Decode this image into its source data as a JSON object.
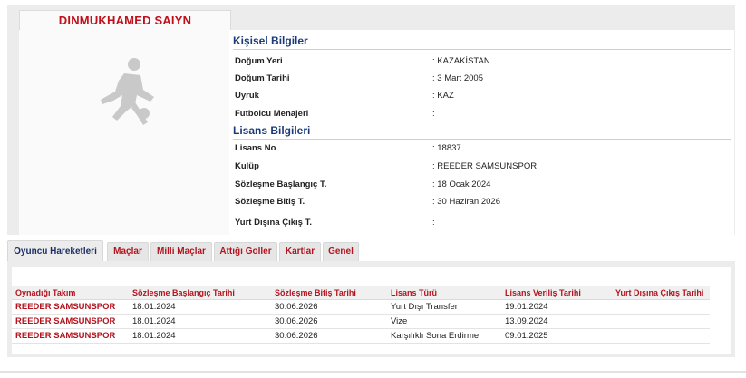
{
  "player": {
    "name": "DINMUKHAMED SAIYN"
  },
  "personal": {
    "title": "Kişisel Bilgiler",
    "rows": [
      {
        "label": "Doğum Yeri",
        "value": ":  KAZAKİSTAN"
      },
      {
        "label": "Doğum Tarihi",
        "value": ":  3 Mart 2005"
      },
      {
        "label": "Uyruk",
        "value": ":  KAZ"
      },
      {
        "label": "Futbolcu Menajeri",
        "value": ":"
      }
    ]
  },
  "license": {
    "title": "Lisans Bilgileri",
    "rows": [
      {
        "label": "Lisans No",
        "value": ": 18837"
      },
      {
        "label": "Kulüp",
        "value": ": REEDER SAMSUNSPOR"
      },
      {
        "label": "Sözleşme Başlangıç T.",
        "value": ": 18 Ocak 2024"
      },
      {
        "label": "Sözleşme Bitiş T.",
        "value": ": 30 Haziran 2026"
      },
      {
        "label": "Yurt Dışına Çıkış T.",
        "value": ":"
      }
    ]
  },
  "tabs": [
    "Oyuncu Hareketleri",
    "Maçlar",
    "Milli Maçlar",
    "Attığı Goller",
    "Kartlar",
    "Genel"
  ],
  "table": {
    "headers": [
      "Oynadığı Takım",
      "Sözleşme Başlangıç Tarihi",
      "Sözleşme Bitiş Tarihi",
      "Lisans Türü",
      "Lisans Veriliş Tarihi",
      "Yurt Dışına Çıkış Tarihi"
    ],
    "rows": [
      [
        "REEDER SAMSUNSPOR",
        "18.01.2024",
        "30.06.2026",
        "Yurt Dışı Transfer",
        "19.01.2024",
        ""
      ],
      [
        "REEDER SAMSUNSPOR",
        "18.01.2024",
        "30.06.2026",
        "Vize",
        "13.09.2024",
        ""
      ],
      [
        "REEDER SAMSUNSPOR",
        "18.01.2024",
        "30.06.2026",
        "Karşılıklı Sona Erdirme",
        "09.01.2025",
        ""
      ]
    ]
  },
  "colors": {
    "accent": "#b3141e",
    "section_title": "#1a3a7a",
    "active_tab": "#1a2f66",
    "panel_bg": "#ececec"
  },
  "icons": {
    "player_placeholder": "footballer-silhouette-icon"
  }
}
